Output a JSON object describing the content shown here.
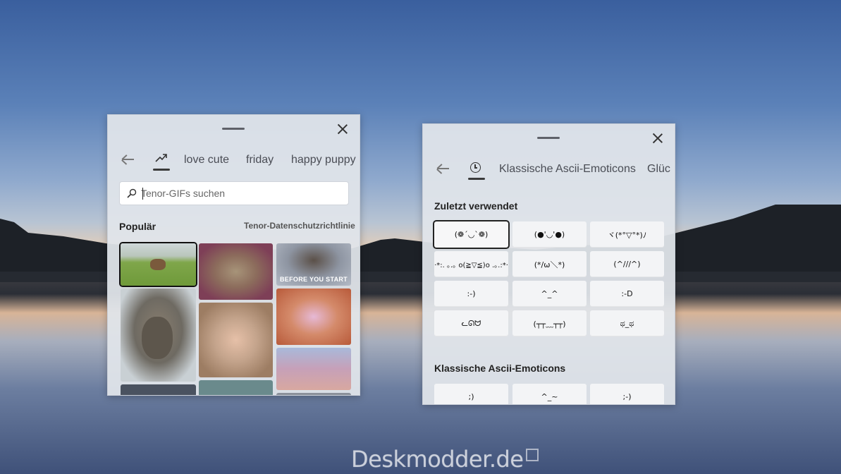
{
  "watermark": "Deskmodder.de",
  "gif_panel": {
    "tabs": [
      {
        "label": "love cute"
      },
      {
        "label": "friday"
      },
      {
        "label": "happy puppy"
      }
    ],
    "trending_icon": "trending-icon",
    "search": {
      "placeholder": "Tenor-GIFs suchen",
      "value": ""
    },
    "section_title": "Populär",
    "privacy_link": "Tenor-Datenschutzrichtlinie",
    "gifs": [
      {
        "name": "gif-dog-running",
        "color": "#6f9a3a",
        "caption": ""
      },
      {
        "name": "gif-quokka",
        "color": "#8a8577",
        "caption": ""
      },
      {
        "name": "gif-andre-giant",
        "color": "#8f5a6a",
        "caption": ""
      },
      {
        "name": "gif-girl-talking",
        "color": "#c5a894",
        "caption": ""
      },
      {
        "name": "gif-before-you-start",
        "color": "#9aa2b1",
        "caption": "BEFORE YOU START"
      },
      {
        "name": "gif-cartoon-bunny",
        "color": "#c97a55",
        "caption": ""
      },
      {
        "name": "gif-cartoon-bird",
        "color": "#c9a3a3",
        "caption": ""
      }
    ]
  },
  "emoticon_panel": {
    "tabs": [
      {
        "label": "Klassische Ascii-Emoticons"
      },
      {
        "label": "Glüc"
      }
    ],
    "recent_title": "Zuletzt verwendet",
    "recent": [
      "(❁´◡`❁)",
      "(●'◡'●)",
      "ヾ(*°▽°*)ﾉ",
      "·*:. ｡.｡ o(≧▽≦)o .｡.:*·",
      "(*/ω＼*)",
      "(^///^)",
      ":-)",
      "^_^",
      ":-D",
      "ᓚᘏᗢ",
      "(┬┬﹏┬┬)",
      "ಥ_ಥ"
    ],
    "classic_title": "Klassische Ascii-Emoticons",
    "classic": [
      ";)",
      "^_~",
      ";-)"
    ]
  }
}
